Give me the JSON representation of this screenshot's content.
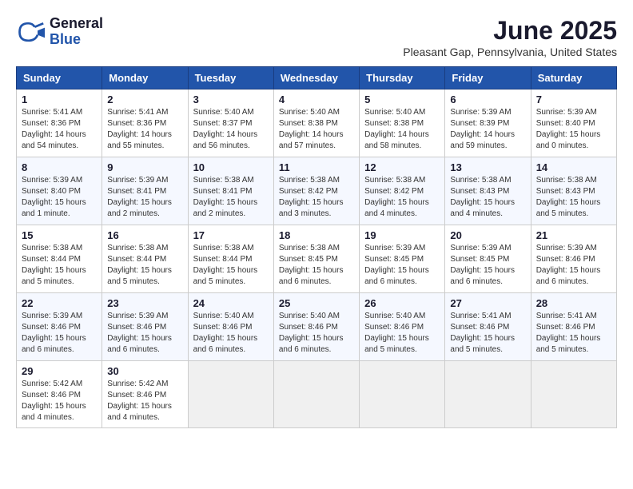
{
  "logo": {
    "general": "General",
    "blue": "Blue"
  },
  "title": "June 2025",
  "subtitle": "Pleasant Gap, Pennsylvania, United States",
  "days": [
    "Sunday",
    "Monday",
    "Tuesday",
    "Wednesday",
    "Thursday",
    "Friday",
    "Saturday"
  ],
  "weeks": [
    [
      {
        "day": "1",
        "sunrise": "Sunrise: 5:41 AM",
        "sunset": "Sunset: 8:36 PM",
        "daylight": "Daylight: 14 hours and 54 minutes."
      },
      {
        "day": "2",
        "sunrise": "Sunrise: 5:41 AM",
        "sunset": "Sunset: 8:36 PM",
        "daylight": "Daylight: 14 hours and 55 minutes."
      },
      {
        "day": "3",
        "sunrise": "Sunrise: 5:40 AM",
        "sunset": "Sunset: 8:37 PM",
        "daylight": "Daylight: 14 hours and 56 minutes."
      },
      {
        "day": "4",
        "sunrise": "Sunrise: 5:40 AM",
        "sunset": "Sunset: 8:38 PM",
        "daylight": "Daylight: 14 hours and 57 minutes."
      },
      {
        "day": "5",
        "sunrise": "Sunrise: 5:40 AM",
        "sunset": "Sunset: 8:38 PM",
        "daylight": "Daylight: 14 hours and 58 minutes."
      },
      {
        "day": "6",
        "sunrise": "Sunrise: 5:39 AM",
        "sunset": "Sunset: 8:39 PM",
        "daylight": "Daylight: 14 hours and 59 minutes."
      },
      {
        "day": "7",
        "sunrise": "Sunrise: 5:39 AM",
        "sunset": "Sunset: 8:40 PM",
        "daylight": "Daylight: 15 hours and 0 minutes."
      }
    ],
    [
      {
        "day": "8",
        "sunrise": "Sunrise: 5:39 AM",
        "sunset": "Sunset: 8:40 PM",
        "daylight": "Daylight: 15 hours and 1 minute."
      },
      {
        "day": "9",
        "sunrise": "Sunrise: 5:39 AM",
        "sunset": "Sunset: 8:41 PM",
        "daylight": "Daylight: 15 hours and 2 minutes."
      },
      {
        "day": "10",
        "sunrise": "Sunrise: 5:38 AM",
        "sunset": "Sunset: 8:41 PM",
        "daylight": "Daylight: 15 hours and 2 minutes."
      },
      {
        "day": "11",
        "sunrise": "Sunrise: 5:38 AM",
        "sunset": "Sunset: 8:42 PM",
        "daylight": "Daylight: 15 hours and 3 minutes."
      },
      {
        "day": "12",
        "sunrise": "Sunrise: 5:38 AM",
        "sunset": "Sunset: 8:42 PM",
        "daylight": "Daylight: 15 hours and 4 minutes."
      },
      {
        "day": "13",
        "sunrise": "Sunrise: 5:38 AM",
        "sunset": "Sunset: 8:43 PM",
        "daylight": "Daylight: 15 hours and 4 minutes."
      },
      {
        "day": "14",
        "sunrise": "Sunrise: 5:38 AM",
        "sunset": "Sunset: 8:43 PM",
        "daylight": "Daylight: 15 hours and 5 minutes."
      }
    ],
    [
      {
        "day": "15",
        "sunrise": "Sunrise: 5:38 AM",
        "sunset": "Sunset: 8:44 PM",
        "daylight": "Daylight: 15 hours and 5 minutes."
      },
      {
        "day": "16",
        "sunrise": "Sunrise: 5:38 AM",
        "sunset": "Sunset: 8:44 PM",
        "daylight": "Daylight: 15 hours and 5 minutes."
      },
      {
        "day": "17",
        "sunrise": "Sunrise: 5:38 AM",
        "sunset": "Sunset: 8:44 PM",
        "daylight": "Daylight: 15 hours and 5 minutes."
      },
      {
        "day": "18",
        "sunrise": "Sunrise: 5:38 AM",
        "sunset": "Sunset: 8:45 PM",
        "daylight": "Daylight: 15 hours and 6 minutes."
      },
      {
        "day": "19",
        "sunrise": "Sunrise: 5:39 AM",
        "sunset": "Sunset: 8:45 PM",
        "daylight": "Daylight: 15 hours and 6 minutes."
      },
      {
        "day": "20",
        "sunrise": "Sunrise: 5:39 AM",
        "sunset": "Sunset: 8:45 PM",
        "daylight": "Daylight: 15 hours and 6 minutes."
      },
      {
        "day": "21",
        "sunrise": "Sunrise: 5:39 AM",
        "sunset": "Sunset: 8:46 PM",
        "daylight": "Daylight: 15 hours and 6 minutes."
      }
    ],
    [
      {
        "day": "22",
        "sunrise": "Sunrise: 5:39 AM",
        "sunset": "Sunset: 8:46 PM",
        "daylight": "Daylight: 15 hours and 6 minutes."
      },
      {
        "day": "23",
        "sunrise": "Sunrise: 5:39 AM",
        "sunset": "Sunset: 8:46 PM",
        "daylight": "Daylight: 15 hours and 6 minutes."
      },
      {
        "day": "24",
        "sunrise": "Sunrise: 5:40 AM",
        "sunset": "Sunset: 8:46 PM",
        "daylight": "Daylight: 15 hours and 6 minutes."
      },
      {
        "day": "25",
        "sunrise": "Sunrise: 5:40 AM",
        "sunset": "Sunset: 8:46 PM",
        "daylight": "Daylight: 15 hours and 6 minutes."
      },
      {
        "day": "26",
        "sunrise": "Sunrise: 5:40 AM",
        "sunset": "Sunset: 8:46 PM",
        "daylight": "Daylight: 15 hours and 5 minutes."
      },
      {
        "day": "27",
        "sunrise": "Sunrise: 5:41 AM",
        "sunset": "Sunset: 8:46 PM",
        "daylight": "Daylight: 15 hours and 5 minutes."
      },
      {
        "day": "28",
        "sunrise": "Sunrise: 5:41 AM",
        "sunset": "Sunset: 8:46 PM",
        "daylight": "Daylight: 15 hours and 5 minutes."
      }
    ],
    [
      {
        "day": "29",
        "sunrise": "Sunrise: 5:42 AM",
        "sunset": "Sunset: 8:46 PM",
        "daylight": "Daylight: 15 hours and 4 minutes."
      },
      {
        "day": "30",
        "sunrise": "Sunrise: 5:42 AM",
        "sunset": "Sunset: 8:46 PM",
        "daylight": "Daylight: 15 hours and 4 minutes."
      },
      null,
      null,
      null,
      null,
      null
    ]
  ]
}
